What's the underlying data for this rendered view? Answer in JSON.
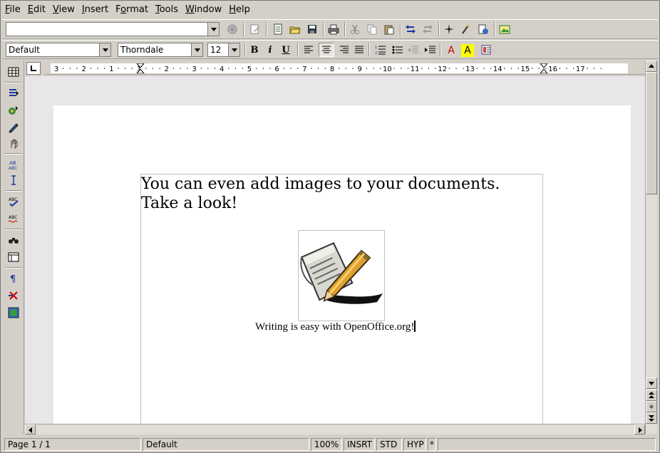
{
  "menu": [
    {
      "u": "F",
      "rest": "ile"
    },
    {
      "u": "E",
      "rest": "dit"
    },
    {
      "u": "V",
      "rest": "iew"
    },
    {
      "u": "I",
      "rest": "nsert"
    },
    {
      "pre": "F",
      "u": "o",
      "rest": "rmat"
    },
    {
      "u": "T",
      "rest": "ools"
    },
    {
      "u": "W",
      "rest": "indow"
    },
    {
      "u": "H",
      "rest": "elp"
    }
  ],
  "function_bar": {
    "url_value": ""
  },
  "object_bar": {
    "paragraph_style": "Default",
    "font_name": "Thorndale",
    "font_size": "12",
    "bold_label": "B",
    "italic_label": "i",
    "underline_label": "U",
    "font_color_label": "A",
    "highlight_label": "A"
  },
  "ruler": {
    "labels": [
      "3",
      "2",
      "1",
      "1",
      "2",
      "3",
      "4",
      "5",
      "6",
      "7",
      "8",
      "9",
      "10",
      "11",
      "12",
      "13",
      "14",
      "15",
      "16",
      "17"
    ]
  },
  "document": {
    "line1": "You can even add images to your documents.",
    "line2": "Take a look!",
    "caption": "Writing is easy with OpenOffice.org!"
  },
  "status": {
    "page": "Page 1 / 1",
    "page_style": "Default",
    "zoom": "100%",
    "insert_mode": "INSRT",
    "selection_mode": "STD",
    "hyperlink_mode": "HYP",
    "modified": "*"
  },
  "colors": {
    "toolbar_bg": "#d4d0c8",
    "doc_bg": "#e8e6e8",
    "page": "#ffffff",
    "font_color_icon": "#cc0000",
    "highlight_icon": "#ffff00"
  }
}
